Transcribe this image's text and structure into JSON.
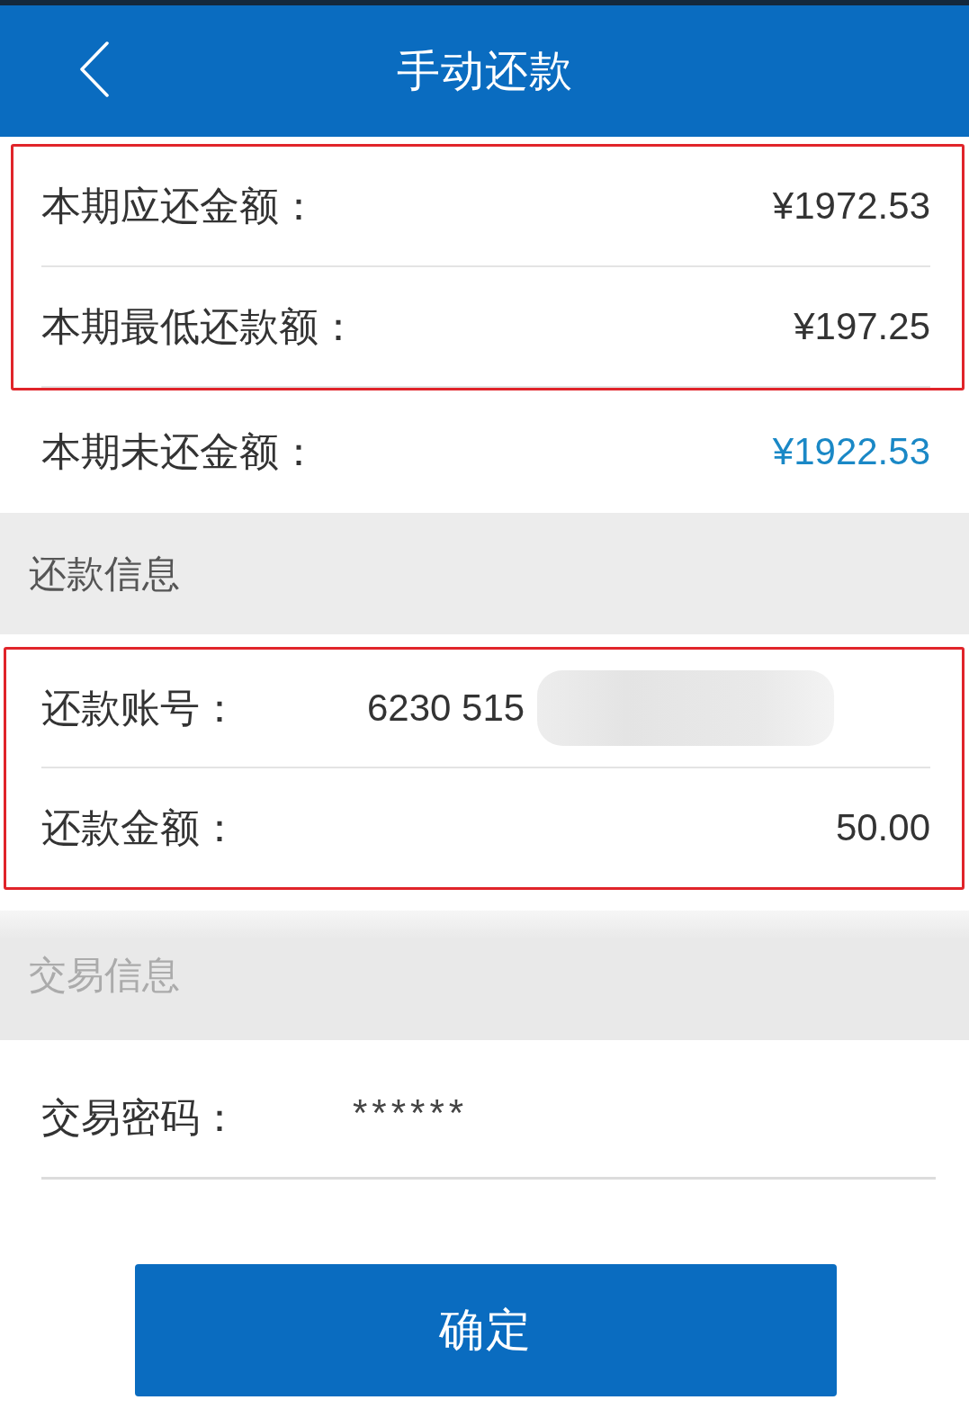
{
  "header": {
    "title": "手动还款"
  },
  "summary": {
    "groups": [
      {
        "framed": true,
        "rows": [
          {
            "label": "本期应还金额：",
            "value": "¥1972.53",
            "emphasis": false
          },
          {
            "label": "本期最低还款额：",
            "value": "¥197.25",
            "emphasis": false
          }
        ]
      },
      {
        "framed": false,
        "rows": [
          {
            "label": "本期未还金额：",
            "value": "¥1922.53",
            "emphasis": true
          }
        ]
      }
    ]
  },
  "repayment_section": {
    "title": "还款信息",
    "framed": true,
    "account": {
      "label": "还款账号：",
      "value": "6230 515",
      "redacted": true
    },
    "amount": {
      "label": "还款金额：",
      "value": "50.00"
    }
  },
  "transaction_section": {
    "title": "交易信息",
    "password": {
      "label": "交易密码：",
      "value": "******"
    }
  },
  "confirm_button": {
    "label": "确定"
  }
}
